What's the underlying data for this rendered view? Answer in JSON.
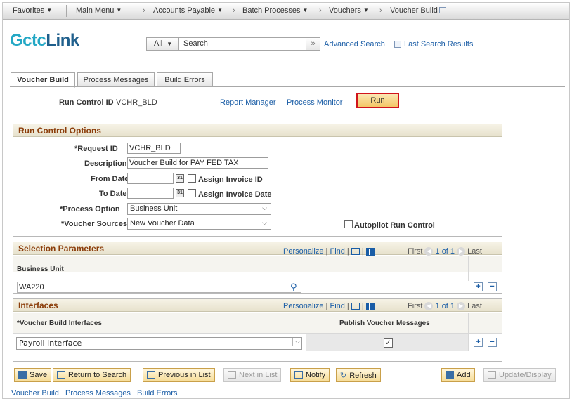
{
  "navbar": {
    "favorites": "Favorites",
    "main_menu": "Main Menu",
    "breadcrumbs": [
      "Accounts Payable",
      "Batch Processes",
      "Vouchers",
      "Voucher Build"
    ]
  },
  "header": {
    "logo": {
      "prefix": "",
      "ctc": "ctc",
      "link": "Link",
      "mark": "G"
    },
    "search_scope": "All",
    "search_placeholder": "Search",
    "advanced_search": "Advanced Search",
    "last_search_results": "Last Search Results"
  },
  "tabs": [
    {
      "label": "Voucher Build",
      "active": true
    },
    {
      "label": "Process Messages",
      "active": false
    },
    {
      "label": "Build Errors",
      "active": false
    }
  ],
  "run_control": {
    "label": "Run Control ID",
    "value": "VCHR_BLD",
    "report_manager": "Report Manager",
    "process_monitor": "Process Monitor",
    "run_label": "Run"
  },
  "run_control_options": {
    "title": "Run Control Options",
    "request_id_label": "*Request ID",
    "request_id": "VCHR_BLD",
    "description_label": "Description",
    "description": "Voucher Build for PAY FED TAX",
    "from_date_label": "From Date",
    "from_date": "",
    "assign_invoice_id": "Assign Invoice ID",
    "to_date_label": "To Date",
    "to_date": "",
    "assign_invoice_date": "Assign Invoice Date",
    "process_option_label": "*Process Option",
    "process_option": "Business Unit",
    "voucher_sources_label": "*Voucher Sources",
    "voucher_sources": "New Voucher Data",
    "autopilot": "Autopilot Run Control"
  },
  "selection_parameters": {
    "title": "Selection Parameters",
    "personalize": "Personalize",
    "find": "Find",
    "first": "First",
    "count": "1 of 1",
    "last": "Last",
    "column": "Business Unit",
    "rows": [
      "WA220"
    ]
  },
  "interfaces": {
    "title": "Interfaces",
    "personalize": "Personalize",
    "find": "Find",
    "first": "First",
    "count": "1 of 1",
    "last": "Last",
    "col_interfaces": "*Voucher Build Interfaces",
    "col_publish": "Publish Voucher Messages",
    "rows": [
      {
        "interface": "Payroll Interface",
        "publish": true
      }
    ]
  },
  "toolbar": {
    "save": "Save",
    "return_to_search": "Return to Search",
    "previous_in_list": "Previous in List",
    "next_in_list": "Next in List",
    "notify": "Notify",
    "refresh": "Refresh",
    "add": "Add",
    "update_display": "Update/Display"
  },
  "footer": {
    "links": [
      "Voucher Build",
      "Process Messages",
      "Build Errors"
    ]
  },
  "colors": {
    "group_title": "#8b3d0a",
    "link": "#1a5da6",
    "run_highlight": "#d0141b"
  }
}
